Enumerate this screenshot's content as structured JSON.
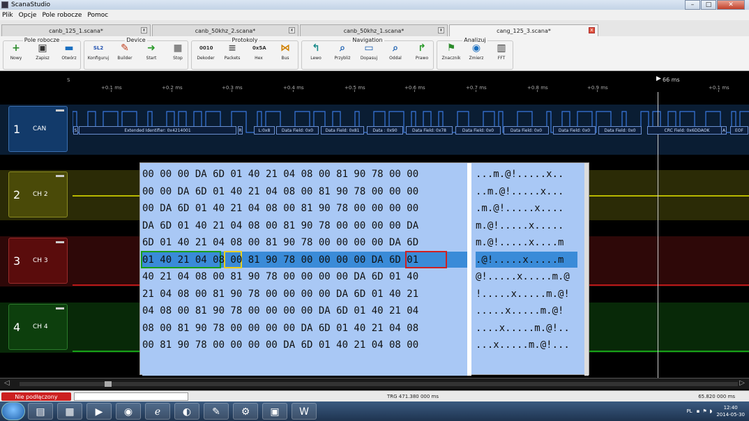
{
  "window": {
    "title": "ScanaStudio",
    "min": "–",
    "max": "□",
    "close": "✕"
  },
  "menu": [
    "Plik",
    "Opcje",
    "Pole robocze",
    "Pomoc"
  ],
  "tabs": [
    {
      "label": "canb_125_1.scana*",
      "active": false
    },
    {
      "label": "canb_50khz_2.scana*",
      "active": false
    },
    {
      "label": "canb_50khz_1.scana*",
      "active": false
    },
    {
      "label": "cang_125_3.scana*",
      "active": true
    }
  ],
  "toolbar": {
    "groups": [
      "Pole robocze",
      "Device",
      "Protokoly",
      "Navigation",
      "Analizuj"
    ],
    "buttons": [
      {
        "label": "Nowy",
        "icon": "new-icon",
        "glyph": "+",
        "color": "#2a8a2a"
      },
      {
        "label": "Zapisz",
        "icon": "save-icon",
        "glyph": "▣",
        "color": "#333"
      },
      {
        "label": "Otwórz",
        "icon": "open-icon",
        "glyph": "▬",
        "color": "#1a6fc0"
      },
      {
        "label": "Konfiguruj",
        "icon": "configure-icon",
        "glyph": "SL2",
        "color": "#2050b0"
      },
      {
        "label": "Builder",
        "icon": "builder-icon",
        "glyph": "✎",
        "color": "#c04020"
      },
      {
        "label": "Start",
        "icon": "start-icon",
        "glyph": "➜",
        "color": "#2a9a2a"
      },
      {
        "label": "Stop",
        "icon": "stop-icon",
        "glyph": "■",
        "color": "#888"
      },
      {
        "label": "Dekoder",
        "icon": "decoder-icon",
        "glyph": "0010",
        "color": "#333"
      },
      {
        "label": "Packets",
        "icon": "packets-icon",
        "glyph": "≡",
        "color": "#555"
      },
      {
        "label": "Hex",
        "icon": "hex-icon",
        "glyph": "0x5A",
        "color": "#333"
      },
      {
        "label": "Bus",
        "icon": "bus-icon",
        "glyph": "⋈",
        "color": "#d08000"
      },
      {
        "label": "Lewo",
        "icon": "left-icon",
        "glyph": "↰",
        "color": "#1a8a8a"
      },
      {
        "label": "Przybliż",
        "icon": "zoom-in-icon",
        "glyph": "⌕",
        "color": "#1a5fb0"
      },
      {
        "label": "Dopasuj",
        "icon": "fit-icon",
        "glyph": "▭",
        "color": "#1a5fb0"
      },
      {
        "label": "Oddal",
        "icon": "zoom-out-icon",
        "glyph": "⌕",
        "color": "#1a5fb0"
      },
      {
        "label": "Prawo",
        "icon": "right-icon",
        "glyph": "↱",
        "color": "#2a9a2a"
      },
      {
        "label": "Znacznik",
        "icon": "marker-icon",
        "glyph": "⚑",
        "color": "#2a8a2a"
      },
      {
        "label": "Zmierz",
        "icon": "measure-icon",
        "glyph": "◉",
        "color": "#1a6fc0"
      },
      {
        "label": "FFT",
        "icon": "fft-icon",
        "glyph": "▥",
        "color": "#333"
      }
    ]
  },
  "timeline": {
    "start": "S",
    "ticks": [
      "+0.1 ms",
      "+0.2 ms",
      "+0.3 ms",
      "+0.4 ms",
      "+0.5 ms",
      "+0.6 ms",
      "+0.7 ms",
      "+0.8 ms",
      "+0.9 ms",
      "+0.1 ms"
    ],
    "marker": "66 ms"
  },
  "channels": [
    {
      "num": "1",
      "name": "CAN",
      "color": "#123a6a"
    },
    {
      "num": "2",
      "name": "CH 2",
      "color": "#4a4a08"
    },
    {
      "num": "3",
      "name": "CH 3",
      "color": "#5a0c0c"
    },
    {
      "num": "4",
      "name": "CH 4",
      "color": "#0d3f0d"
    }
  ],
  "decoded_fields": [
    "S",
    "Extended Identifier: 0x4214001",
    "R",
    "L:0x8",
    "Data Field: 0x0",
    "Data Field: 0x81",
    "Data : 0x90",
    "Data Field: 0x78",
    "Data Field: 0x0",
    "Data Field: 0x0",
    "Data Field: 0x0",
    "Data Field: 0x0",
    "CRC Field: 0x6DDAOK",
    "A",
    "EOF"
  ],
  "hex_rows": [
    "00 00 00 DA 6D 01 40 21 04 08 00 81 90 78 00 00",
    "00 00 DA 6D 01 40 21 04 08 00 81 90 78 00 00 00",
    "00 DA 6D 01 40 21 04 08 00 81 90 78 00 00 00 00",
    "DA 6D 01 40 21 04 08 00 81 90 78 00 00 00 00 DA",
    "6D 01 40 21 04 08 00 81 90 78 00 00 00 00 DA 6D",
    "01 40 21 04 08 00 81 90 78 00 00 00 00 DA 6D 01",
    "40 21 04 08 00 81 90 78 00 00 00 00 DA 6D 01 40",
    "21 04 08 00 81 90 78 00 00 00 00 DA 6D 01 40 21",
    "04 08 00 81 90 78 00 00 00 00 DA 6D 01 40 21 04",
    "08 00 81 90 78 00 00 00 00 DA 6D 01 40 21 04 08",
    "00 81 90 78 00 00 00 00 DA 6D 01 40 21 04 08 00"
  ],
  "ascii_rows": [
    "...m.@!.....x..",
    "..m.@!.....x...",
    ".m.@!.....x....",
    "m.@!.....x.....",
    "m.@!.....x....m",
    ".@!.....x.....m",
    "@!.....x.....m.@",
    "!.....x.....m.@!",
    ".....x.....m.@!",
    "....x.....m.@!..",
    "...x.....m.@!..."
  ],
  "highlight_row": 5,
  "status": {
    "connection": "Nie podłączony",
    "trg": "TRG 471.380 000 ms",
    "total": "65.820 000 ms"
  },
  "taskbar": {
    "apps": [
      "explorer-icon",
      "scanastudio-icon",
      "media-icon",
      "chrome-icon",
      "ie-icon",
      "firefox-icon",
      "paint-icon",
      "tools-icon",
      "scanastudio-task-icon",
      "word-icon"
    ],
    "tray_lang": "PL",
    "time": "12:40",
    "date": "2014-05-30"
  }
}
